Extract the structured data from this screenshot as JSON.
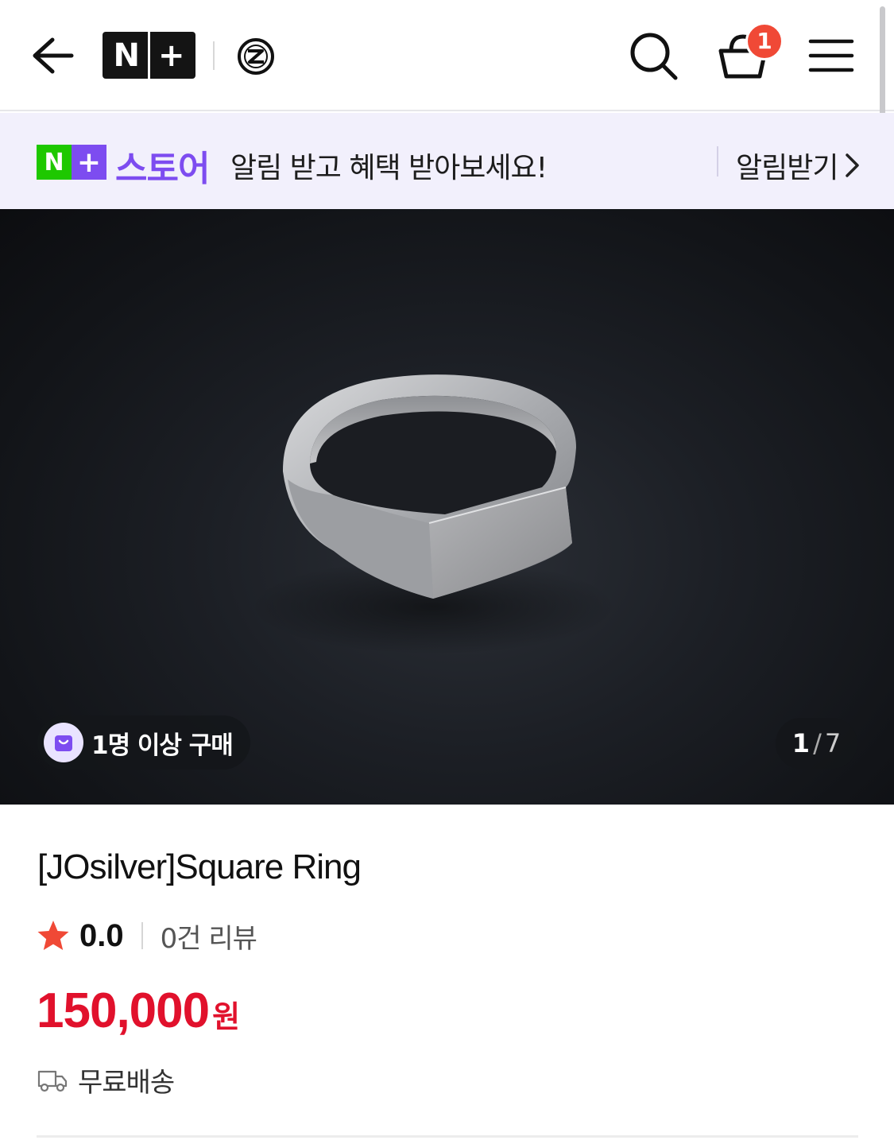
{
  "header": {
    "logo_text": "N+",
    "cart_count": "1",
    "icons": [
      "back-arrow-icon",
      "naver-plus-logo",
      "brand-logo-icon",
      "search-icon",
      "cart-icon",
      "menu-icon"
    ]
  },
  "promo": {
    "logo_n": "N",
    "logo_plus": "+",
    "store_label": "스토어",
    "message": "알림 받고 혜택 받아보세요!",
    "action_label": "알림받기"
  },
  "gallery": {
    "buyer_badge": "1명 이상 구매",
    "current": "1",
    "separator": "/",
    "total": "7"
  },
  "product": {
    "title": "[JOsilver]Square Ring",
    "rating": "0.0",
    "review_count": "0건 리뷰",
    "price": "150,000",
    "currency": "원",
    "shipping": "무료배송"
  },
  "colors": {
    "price_red": "#e1112c",
    "promo_purple": "#7d4cf0",
    "naver_green": "#1ec800",
    "badge_red": "#f04936",
    "star_red": "#f04936"
  }
}
